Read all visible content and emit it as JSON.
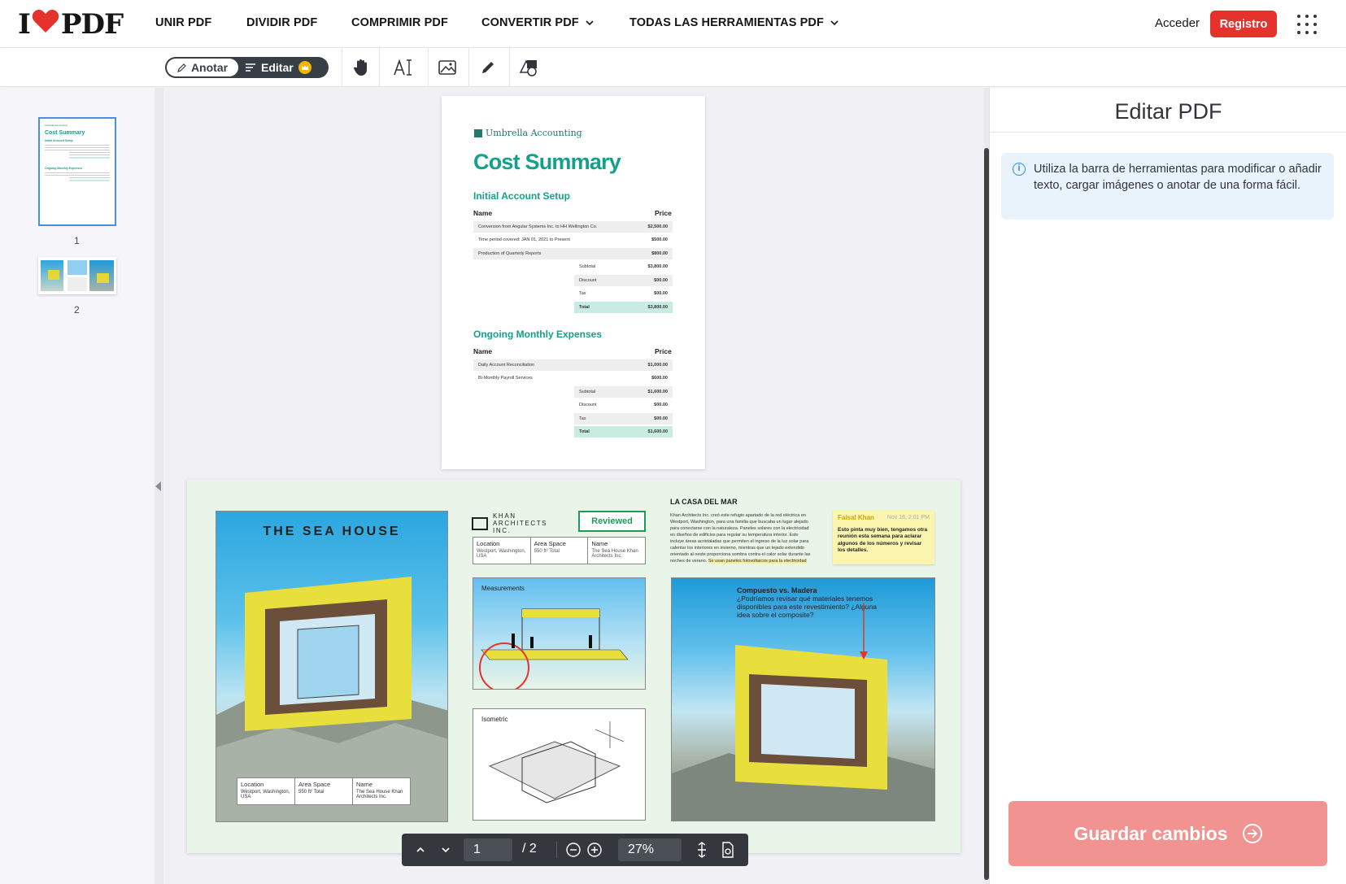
{
  "brand": {
    "logo_left": "I",
    "logo_right": "PDF",
    "accent": "#e5322d"
  },
  "nav": {
    "items": [
      {
        "label": "UNIR PDF"
      },
      {
        "label": "DIVIDIR PDF"
      },
      {
        "label": "COMPRIMIR PDF"
      },
      {
        "label": "CONVERTIR PDF"
      },
      {
        "label": "TODAS LAS HERRAMIENTAS PDF"
      }
    ],
    "login": "Acceder",
    "register": "Registro"
  },
  "toolbar": {
    "mode_annotate": "Anotar",
    "mode_edit": "Editar",
    "tools": [
      "hand-icon",
      "add-text-icon",
      "image-icon",
      "pencil-icon",
      "shapes-icon"
    ]
  },
  "thumbnails": {
    "page1_num": "1",
    "page2_num": "2"
  },
  "page1": {
    "brand": "Umbrella Accounting",
    "title": "Cost Summary",
    "section1": "Initial Account Setup",
    "section2": "Ongoing Monthly Expenses",
    "col_name": "Name",
    "col_price": "Price",
    "rows1": [
      {
        "name": "Conversion from Angular Systems Inc. to HH Wellington Co.",
        "price": "$2,500.00"
      },
      {
        "name": "Time period covered: JAN 01, 2021 to Present",
        "price": "$500.00"
      },
      {
        "name": "Production of Quarterly Reports",
        "price": "$800.00"
      }
    ],
    "totals1": [
      {
        "label": "Subtotal",
        "value": "$3,800.00"
      },
      {
        "label": "Discount",
        "value": "$00.00"
      },
      {
        "label": "Tax",
        "value": "$00.00"
      },
      {
        "label": "Total",
        "value": "$3,800.00"
      }
    ],
    "rows2": [
      {
        "name": "Daily Account Reconciliation",
        "price": "$1,000.00"
      },
      {
        "name": "Bi-Monthly Payroll Services",
        "price": "$600.00"
      }
    ],
    "totals2": [
      {
        "label": "Subtotal",
        "value": "$1,600.00"
      },
      {
        "label": "Discount",
        "value": "$00.00"
      },
      {
        "label": "Tax",
        "value": "$00.00"
      },
      {
        "label": "Total",
        "value": "$1,600.00"
      }
    ]
  },
  "page2": {
    "sea_title": "THE SEA HOUSE",
    "info_labels": [
      "Location",
      "Area Space",
      "Name"
    ],
    "info_values": [
      "Westport, Washington, USA",
      "550 ft² Total",
      "The Sea House Khan Architects Inc."
    ],
    "khan": "KHAN ARCHITECTS INC.",
    "reviewed": "Reviewed",
    "measurements": "Measurements",
    "isometric": "Isometric",
    "casa_title": "LA CASA DEL MAR",
    "casa_text": "Khan Architects Inc. creó este refugio apartado de la red eléctrica en Westport, Washington, para una familia que buscaba un lugar alejado para conectarse con la naturaleza. Paneles solares con la electricidad en diseños de edificios para regular su temperatura interior. Esto incluye áreas acristaladas que permiten el ingreso de la luz solar para calentar los interiores en invierno, mientras que un tejado extendido orientado al oeste proporciona sombra contra el calor solar durante las noches de verano.",
    "casa_highlight": "Se usan paneles fotovoltaicos para la electricidad",
    "note_author": "Faisal Khan",
    "note_date": "Nov 16, 2:01 PM",
    "note_text": "Esto pinta muy bien, tengamos otra reunión esta semana para aclarar algunos de los números y revisar los detalles.",
    "caption_title": "Compuesto vs. Madera",
    "caption_text": "¿Podríamos revisar qué materiales tenemos disponibles para este revestimiento? ¿Alguna idea sobre el composite?"
  },
  "pager": {
    "current": "1",
    "total": "/ 2",
    "zoom": "27%"
  },
  "panel": {
    "title": "Editar PDF",
    "info": "Utiliza la barra de herramientas para modificar o añadir texto, cargar imágenes o anotar de una forma fácil.",
    "save": "Guardar cambios"
  }
}
